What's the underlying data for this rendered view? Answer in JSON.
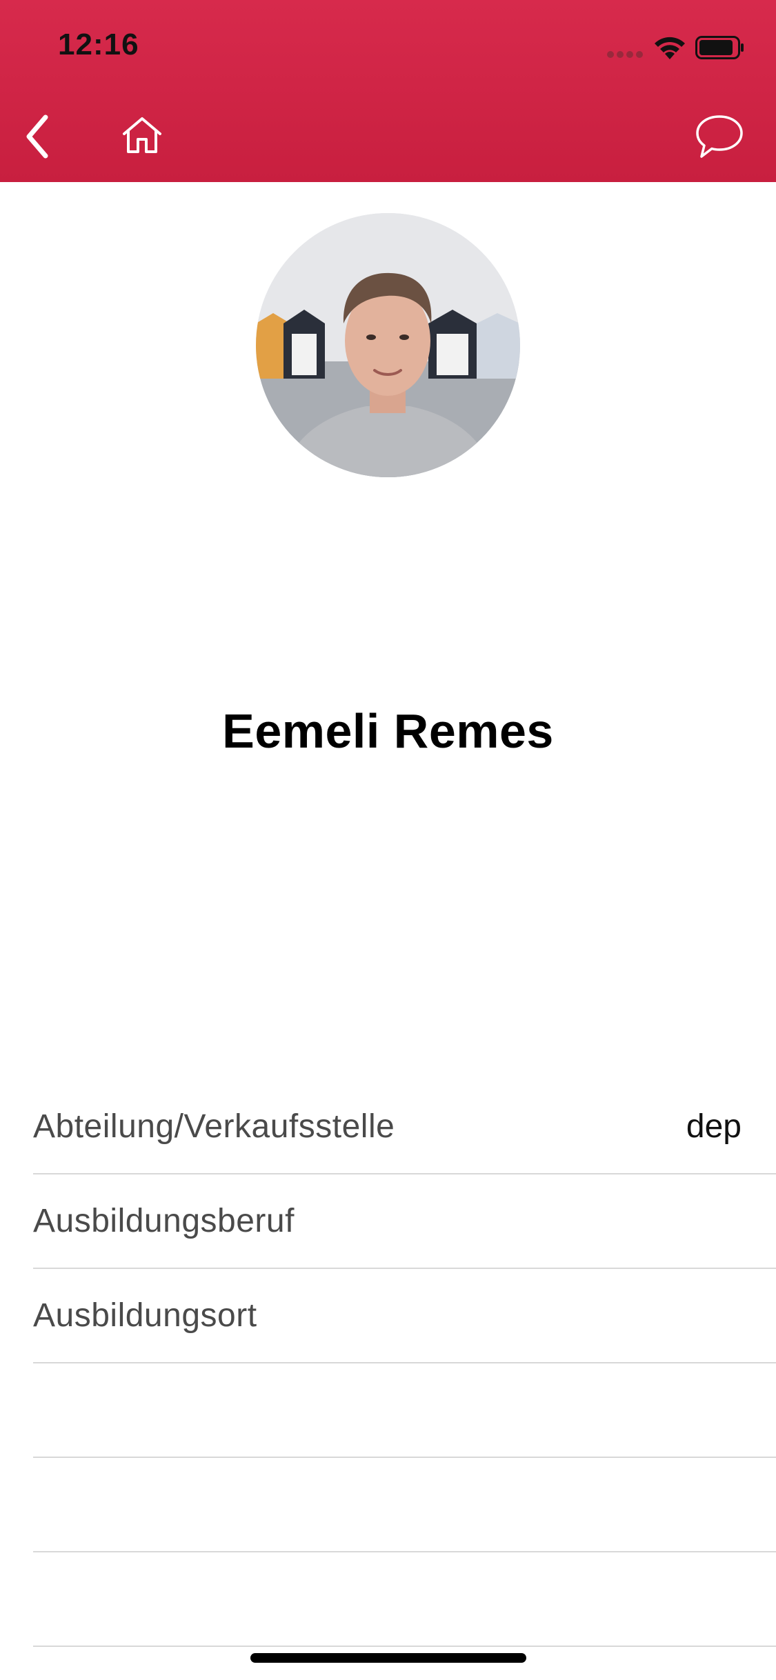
{
  "status_bar": {
    "time": "12:16"
  },
  "nav": {
    "back_icon": "chevron-left-icon",
    "home_icon": "home-icon",
    "chat_icon": "speech-bubble-icon"
  },
  "colors": {
    "header": "#d12645",
    "text_primary": "#000000",
    "text_label": "#4a4a4a",
    "divider": "#d8d8d8"
  },
  "profile": {
    "name": "Eemeli Remes"
  },
  "info_rows": [
    {
      "label": "Abteilung/Verkaufsstelle",
      "value": "dep"
    },
    {
      "label": "Ausbildungsberuf",
      "value": ""
    },
    {
      "label": "Ausbildungsort",
      "value": ""
    },
    {
      "label": "",
      "value": ""
    },
    {
      "label": "",
      "value": ""
    },
    {
      "label": "",
      "value": ""
    }
  ]
}
